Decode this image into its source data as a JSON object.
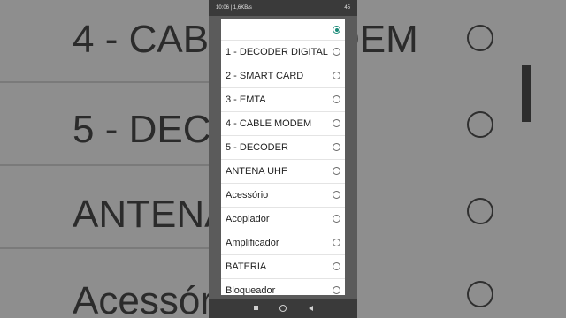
{
  "status": {
    "time": "10:06 | 1,6KB/s",
    "battery": "45"
  },
  "options": [
    {
      "label": "",
      "selected": true
    },
    {
      "label": "1 - DECODER DIGITAL",
      "selected": false
    },
    {
      "label": "2 - SMART CARD",
      "selected": false
    },
    {
      "label": "3 - EMTA",
      "selected": false
    },
    {
      "label": "4 - CABLE MODEM",
      "selected": false
    },
    {
      "label": "5 - DECODER",
      "selected": false
    },
    {
      "label": "ANTENA UHF",
      "selected": false
    },
    {
      "label": "Acessório",
      "selected": false
    },
    {
      "label": "Acoplador",
      "selected": false
    },
    {
      "label": "Amplificador",
      "selected": false
    },
    {
      "label": "BATERIA",
      "selected": false
    },
    {
      "label": "Bloqueador",
      "selected": false
    }
  ],
  "background": {
    "rows": [
      "4 - CABLE MODEM",
      "5 - DECODER",
      "ANTENA UHF",
      "Acessório"
    ]
  },
  "colors": {
    "accent": "#1a8a78",
    "dialog_bg": "#ffffff",
    "overlay_bg": "#8e8e8e"
  },
  "icons": {
    "nav": [
      "recent-apps-icon",
      "home-icon",
      "back-icon"
    ]
  }
}
